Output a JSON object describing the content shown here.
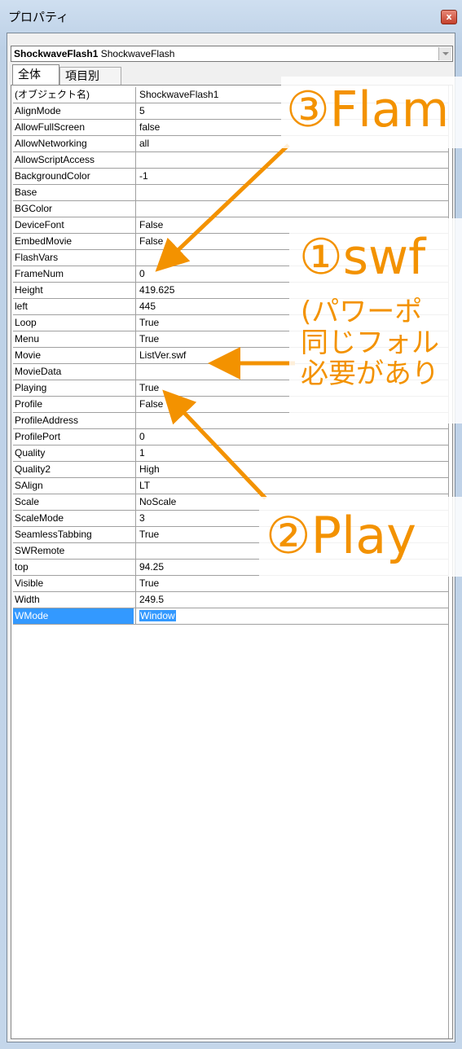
{
  "window": {
    "title": "プロパティ",
    "close_label": "x"
  },
  "object_selector": {
    "name": "ShockwaveFlash1",
    "type": "ShockwaveFlash"
  },
  "tabs": [
    {
      "label": "全体"
    },
    {
      "label": "項目別"
    }
  ],
  "properties": [
    {
      "name": "(オブジェクト名)",
      "value": "ShockwaveFlash1"
    },
    {
      "name": "AlignMode",
      "value": "5"
    },
    {
      "name": "AllowFullScreen",
      "value": "false"
    },
    {
      "name": "AllowNetworking",
      "value": "all"
    },
    {
      "name": "AllowScriptAccess",
      "value": ""
    },
    {
      "name": "BackgroundColor",
      "value": "-1"
    },
    {
      "name": "Base",
      "value": ""
    },
    {
      "name": "BGColor",
      "value": ""
    },
    {
      "name": "DeviceFont",
      "value": "False"
    },
    {
      "name": "EmbedMovie",
      "value": "False"
    },
    {
      "name": "FlashVars",
      "value": ""
    },
    {
      "name": "FrameNum",
      "value": "0"
    },
    {
      "name": "Height",
      "value": "419.625"
    },
    {
      "name": "left",
      "value": "445"
    },
    {
      "name": "Loop",
      "value": "True"
    },
    {
      "name": "Menu",
      "value": "True"
    },
    {
      "name": "Movie",
      "value": "ListVer.swf"
    },
    {
      "name": "MovieData",
      "value": ""
    },
    {
      "name": "Playing",
      "value": "True"
    },
    {
      "name": "Profile",
      "value": "False"
    },
    {
      "name": "ProfileAddress",
      "value": ""
    },
    {
      "name": "ProfilePort",
      "value": "0"
    },
    {
      "name": "Quality",
      "value": "1"
    },
    {
      "name": "Quality2",
      "value": "High"
    },
    {
      "name": "SAlign",
      "value": "LT"
    },
    {
      "name": "Scale",
      "value": "NoScale"
    },
    {
      "name": "ScaleMode",
      "value": "3"
    },
    {
      "name": "SeamlessTabbing",
      "value": "True"
    },
    {
      "name": "SWRemote",
      "value": ""
    },
    {
      "name": "top",
      "value": "94.25"
    },
    {
      "name": "Visible",
      "value": "True"
    },
    {
      "name": "Width",
      "value": "249.5"
    },
    {
      "name": "WMode",
      "value": "Window",
      "selected": true
    }
  ],
  "annotations": {
    "step3": "③Flam",
    "step1": "①swf",
    "note_lines": [
      "(パワーポ",
      "同じフォル",
      "必要があり"
    ],
    "step2": "②Play"
  },
  "colors": {
    "annotation": "#f39200",
    "selection": "#3399ff"
  }
}
